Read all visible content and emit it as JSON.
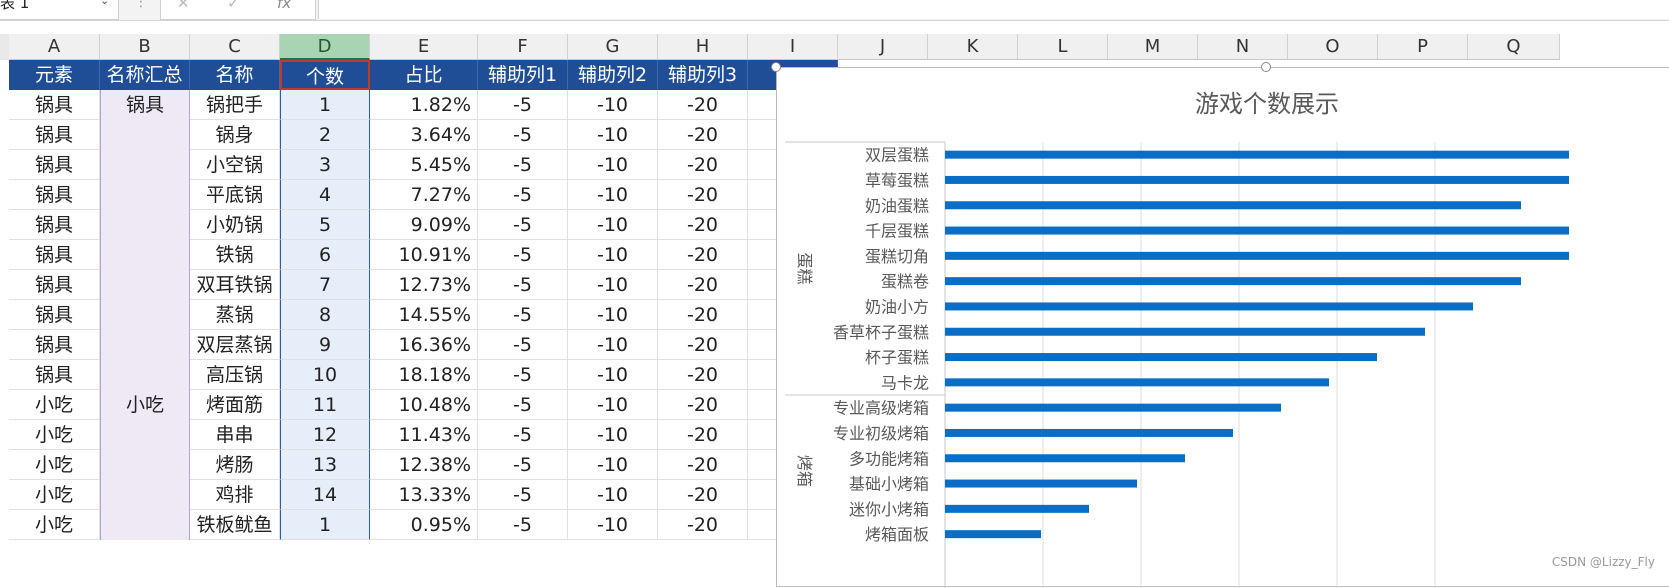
{
  "formula_bar": {
    "name_box": "表 1",
    "chevron": "⌄",
    "dots": "⋮",
    "cancel_icon": "✕",
    "enter_icon": "✓",
    "fx_label": "fx"
  },
  "column_letters": [
    "A",
    "B",
    "C",
    "D",
    "E",
    "F",
    "G",
    "H",
    "I",
    "J",
    "K",
    "L",
    "M",
    "N",
    "O",
    "P",
    "Q"
  ],
  "table": {
    "headers": [
      "元素",
      "名称汇总",
      "名称",
      "个数",
      "占比",
      "辅助列1",
      "辅助列2",
      "辅助列3"
    ],
    "rows": [
      [
        "锅具",
        "锅具",
        "锅把手",
        "1",
        "1.82%",
        "-5",
        "-10",
        "-20"
      ],
      [
        "锅具",
        "",
        "锅身",
        "2",
        "3.64%",
        "-5",
        "-10",
        "-20"
      ],
      [
        "锅具",
        "",
        "小空锅",
        "3",
        "5.45%",
        "-5",
        "-10",
        "-20"
      ],
      [
        "锅具",
        "",
        "平底锅",
        "4",
        "7.27%",
        "-5",
        "-10",
        "-20"
      ],
      [
        "锅具",
        "",
        "小奶锅",
        "5",
        "9.09%",
        "-5",
        "-10",
        "-20"
      ],
      [
        "锅具",
        "",
        "铁锅",
        "6",
        "10.91%",
        "-5",
        "-10",
        "-20"
      ],
      [
        "锅具",
        "",
        "双耳铁锅",
        "7",
        "12.73%",
        "-5",
        "-10",
        "-20"
      ],
      [
        "锅具",
        "",
        "蒸锅",
        "8",
        "14.55%",
        "-5",
        "-10",
        "-20"
      ],
      [
        "锅具",
        "",
        "双层蒸锅",
        "9",
        "16.36%",
        "-5",
        "-10",
        "-20"
      ],
      [
        "锅具",
        "",
        "高压锅",
        "10",
        "18.18%",
        "-5",
        "-10",
        "-20"
      ],
      [
        "小吃",
        "小吃",
        "烤面筋",
        "11",
        "10.48%",
        "-5",
        "-10",
        "-20"
      ],
      [
        "小吃",
        "",
        "串串",
        "12",
        "11.43%",
        "-5",
        "-10",
        "-20"
      ],
      [
        "小吃",
        "",
        "烤肠",
        "13",
        "12.38%",
        "-5",
        "-10",
        "-20"
      ],
      [
        "小吃",
        "",
        "鸡排",
        "14",
        "13.33%",
        "-5",
        "-10",
        "-20"
      ],
      [
        "小吃",
        "",
        "铁板鱿鱼",
        "1",
        "0.95%",
        "-5",
        "-10",
        "-20"
      ]
    ]
  },
  "chart_data": {
    "type": "bar",
    "orientation": "horizontal",
    "title": "游戏个数展示",
    "groups": [
      {
        "name": "蛋糕",
        "categories": [
          "双层蛋糕",
          "草莓蛋糕",
          "奶油蛋糕",
          "千层蛋糕",
          "蛋糕切角",
          "蛋糕卷",
          "奶油小方",
          "香草杯子蛋糕",
          "杯子蛋糕",
          "马卡龙"
        ]
      },
      {
        "name": "烤箱",
        "categories": [
          "专业高级烤箱",
          "专业初级烤箱",
          "多功能烤箱",
          "基础小烤箱",
          "迷你小烤箱",
          "烤箱面板"
        ]
      }
    ],
    "categories": [
      "双层蛋糕",
      "草莓蛋糕",
      "奶油蛋糕",
      "千层蛋糕",
      "蛋糕切角",
      "蛋糕卷",
      "奶油小方",
      "香草杯子蛋糕",
      "杯子蛋糕",
      "马卡龙",
      "专业高级烤箱",
      "专业初级烤箱",
      "多功能烤箱",
      "基础小烤箱",
      "迷你小烤箱",
      "烤箱面板"
    ],
    "values": [
      13,
      13,
      12,
      13,
      13,
      12,
      11,
      10,
      9,
      8,
      7,
      6,
      5,
      4,
      3,
      2
    ],
    "bar_color": "#0b6ec6",
    "grid": true,
    "xlim": [
      0,
      13
    ]
  },
  "watermark": "CSDN @Lizzy_Fly",
  "colors": {
    "header_fill": "#1f4e96",
    "selected_column": "#a9d4b3",
    "bar": "#0b6ec6"
  }
}
